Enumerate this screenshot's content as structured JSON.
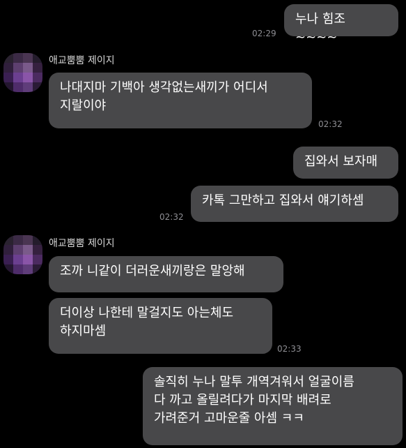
{
  "colors": {
    "background": "#000000",
    "bubble": "#48484a",
    "bubble_text": "#ffffff",
    "timestamp": "#8e8e93",
    "sender_name": "#d6d6d6"
  },
  "messages": [
    {
      "side": "sent",
      "text": "누나 힘조~~~~",
      "time": "02:29"
    },
    {
      "side": "received",
      "sender": "애교뿜뿜 제이지",
      "text": "나대지마 기백아 생각없는새끼가 어디서\n지랄이야",
      "time": "02:32"
    },
    {
      "side": "sent",
      "text": "집와서 보자매"
    },
    {
      "side": "sent",
      "text": "카톡 그만하고 집와서 얘기하셈",
      "time": "02:32"
    },
    {
      "side": "received",
      "sender": "애교뿜뿜 제이지",
      "text": "조까 니같이 더러운새끼랑은 말앙해"
    },
    {
      "side": "received",
      "text": "더이상 나한테 말걸지도 아는체도\n하지마셈",
      "time": "02:33"
    },
    {
      "side": "sent",
      "text": "솔직히 누나 말투 개역겨워서 얼굴이름\n다 까고 올릴려다가 마지막 배려로\n가려준거 고마운줄 아셈 ㅋㅋ"
    }
  ]
}
